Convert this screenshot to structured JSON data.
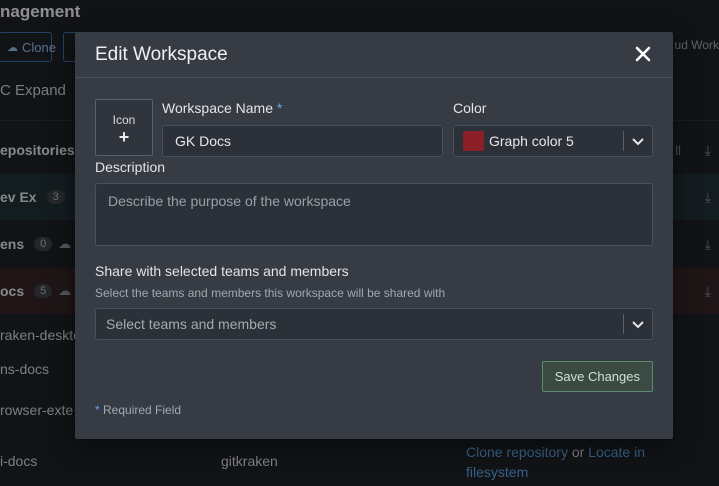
{
  "background": {
    "title": "nagement",
    "clone_button": "Clone",
    "expand_label": "Expand",
    "right_header": "ud Work",
    "section_header": "epositories",
    "section_all": "ll",
    "rows": [
      {
        "name": "ev Ex",
        "count": "3"
      },
      {
        "name": "ens",
        "count": "0"
      },
      {
        "name": "ocs",
        "count": "5"
      },
      {
        "name": "raken-deskto"
      },
      {
        "name": "ns-docs"
      },
      {
        "name": "rowser-exte"
      },
      {
        "name": "i-docs",
        "owner": "gitkraken",
        "link1": "Clone repository",
        "or": "or",
        "link2": "Locate in",
        "link2b": "filesystem"
      }
    ]
  },
  "modal": {
    "title": "Edit Workspace",
    "icon_label": "Icon",
    "icon_plus": "+",
    "workspace_name_label": "Workspace Name",
    "required_mark": "*",
    "workspace_name_value": "GK Docs",
    "color_label": "Color",
    "color_value": "Graph color 5",
    "color_swatch": "#8b1e26",
    "description_label": "Description",
    "description_placeholder": "Describe the purpose of the workspace",
    "share_label": "Share with selected teams and members",
    "share_helper": "Select the teams and members this workspace will be shared with",
    "share_placeholder": "Select teams and members",
    "save_button": "Save Changes",
    "required_note_mark": "*",
    "required_note": "Required Field"
  }
}
